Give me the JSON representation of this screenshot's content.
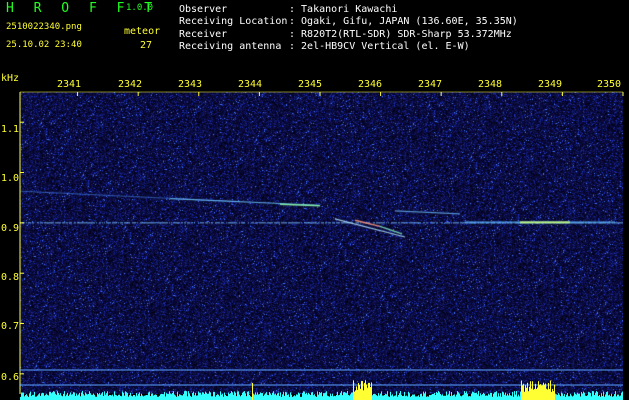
{
  "header": {
    "app_name": "H R O F F T",
    "version": "1.0.0",
    "filename": "2510022340.png",
    "meteor_label": "meteor",
    "meteor_count": "27",
    "timestamp": "25.10.02 23:40",
    "info": [
      {
        "key": "Observer",
        "value": ": Takanori Kawachi"
      },
      {
        "key": "Receiving Location",
        "value": ": Ogaki, Gifu, JAPAN (136.60E, 35.35N)"
      },
      {
        "key": "Receiver",
        "value": ": R820T2(RTL-SDR) SDR-Sharp 53.372MHz"
      },
      {
        "key": "Receiving antenna",
        "value": ": 2el-HB9CV Vertical (el. E-W)"
      }
    ]
  },
  "chart_data": {
    "type": "heatmap",
    "ylabel": "kHz",
    "x_ticks": [
      "2341",
      "2342",
      "2343",
      "2344",
      "2345",
      "2346",
      "2347",
      "2348",
      "2349",
      "2350"
    ],
    "y_ticks": [
      "1.1",
      "1.0",
      "0.9",
      "0.8",
      "0.7",
      "0.6"
    ],
    "y_range_khz": [
      0.56,
      1.16
    ],
    "x_range": [
      2340.05,
      2350.0
    ],
    "colors": {
      "background": "#0a0a3c",
      "axis_text": "#ffff33",
      "bar": "#33ffff",
      "bar_peak": "#ffff33"
    }
  }
}
